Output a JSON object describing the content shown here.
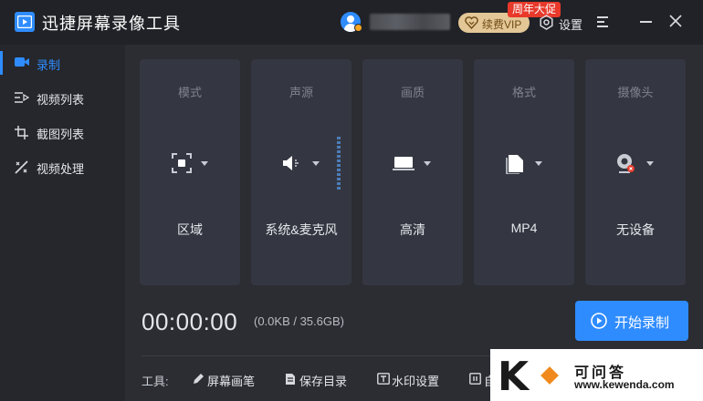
{
  "app": {
    "title": "迅捷屏幕录像工具"
  },
  "header": {
    "vip_label": "续费VIP",
    "promo_badge": "周年大促",
    "settings_label": "设置"
  },
  "sidebar": {
    "items": [
      {
        "label": "录制",
        "icon": "camera-icon",
        "active": true
      },
      {
        "label": "视频列表",
        "icon": "video-list-icon",
        "active": false
      },
      {
        "label": "截图列表",
        "icon": "screenshot-list-icon",
        "active": false
      },
      {
        "label": "视频处理",
        "icon": "video-process-icon",
        "active": false
      }
    ]
  },
  "settings_cards": [
    {
      "title": "模式",
      "value": "区域",
      "icon": "region-icon"
    },
    {
      "title": "声源",
      "value": "系统&麦克风",
      "icon": "speaker-icon"
    },
    {
      "title": "画质",
      "value": "高清",
      "icon": "monitor-icon"
    },
    {
      "title": "格式",
      "value": "MP4",
      "icon": "file-icon"
    },
    {
      "title": "摄像头",
      "value": "无设备",
      "icon": "webcam-icon"
    }
  ],
  "recording": {
    "timer": "00:00:00",
    "storage": "(0.0KB / 35.6GB)",
    "start_label": "开始录制"
  },
  "toolbar": {
    "label": "工具:",
    "items": [
      {
        "label": "屏幕画笔",
        "icon": "pen-icon"
      },
      {
        "label": "保存目录",
        "icon": "folder-icon"
      },
      {
        "label": "水印设置",
        "icon": "watermark-icon"
      },
      {
        "label": "自",
        "icon": "pause-icon"
      }
    ]
  },
  "watermark": {
    "logo_letter": "K",
    "name": "可问答",
    "url": "www.kewenda.com"
  },
  "colors": {
    "accent": "#2f8cff",
    "vip": "#e3c796",
    "promo": "#e8392b"
  }
}
